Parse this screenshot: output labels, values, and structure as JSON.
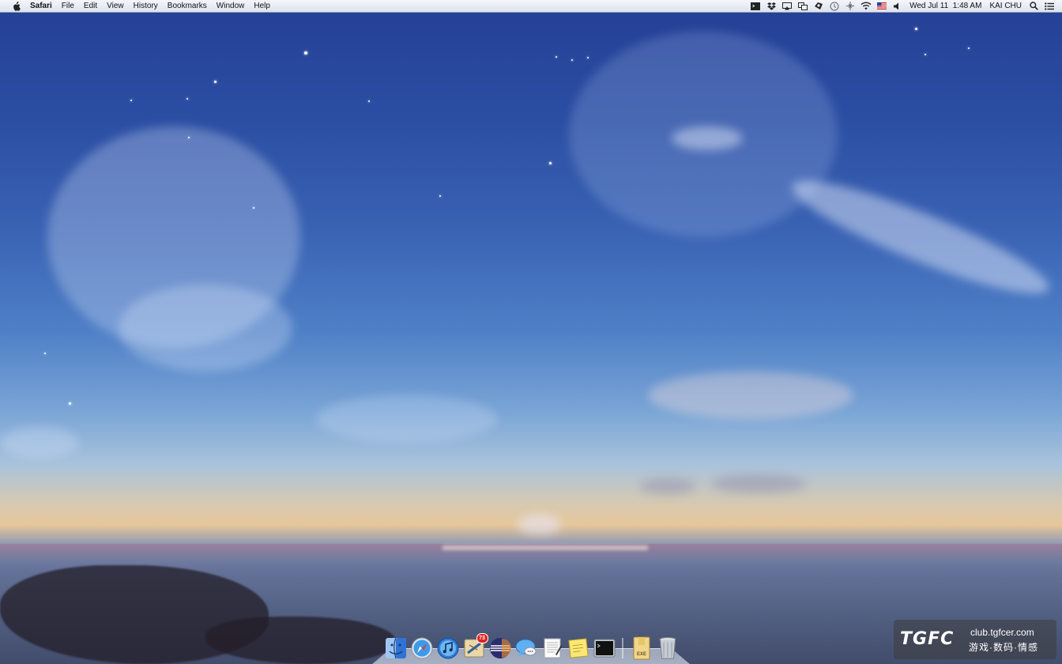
{
  "menubar": {
    "apple_icon": "apple-logo-icon",
    "app_name": "Safari",
    "menus": [
      "File",
      "Edit",
      "View",
      "History",
      "Bookmarks",
      "Window",
      "Help"
    ],
    "status_icons": [
      "terminal-icon",
      "dropbox-icon",
      "airplay-icon",
      "display-icon",
      "sync-icon",
      "time-machine-icon",
      "bluetooth-icon",
      "wifi-icon",
      "us-flag-input-icon",
      "volume-icon"
    ],
    "datetime": "Wed Jul 11  1:48 AM",
    "user": "KAI CHU",
    "spotlight_icon": "spotlight-search-icon",
    "notifications_icon": "notification-list-icon"
  },
  "dock": {
    "apps": [
      {
        "name": "finder-icon"
      },
      {
        "name": "safari-icon"
      },
      {
        "name": "itunes-icon"
      },
      {
        "name": "mail-icon",
        "badge": "73"
      },
      {
        "name": "eclipse-icon"
      },
      {
        "name": "messages-icon"
      },
      {
        "name": "textedit-icon"
      },
      {
        "name": "stickies-icon"
      },
      {
        "name": "terminal-app-icon"
      }
    ],
    "others": [
      {
        "name": "downloads-stack-icon",
        "label": "EXE"
      },
      {
        "name": "trash-icon"
      }
    ]
  },
  "watermark": {
    "logo": "TGFC",
    "url": "club.tgfcer.com",
    "tagline": "游戏·数码·情感"
  },
  "colors": {
    "menubar_bg": "#e6eaf2",
    "badge_red": "#e0221d"
  }
}
